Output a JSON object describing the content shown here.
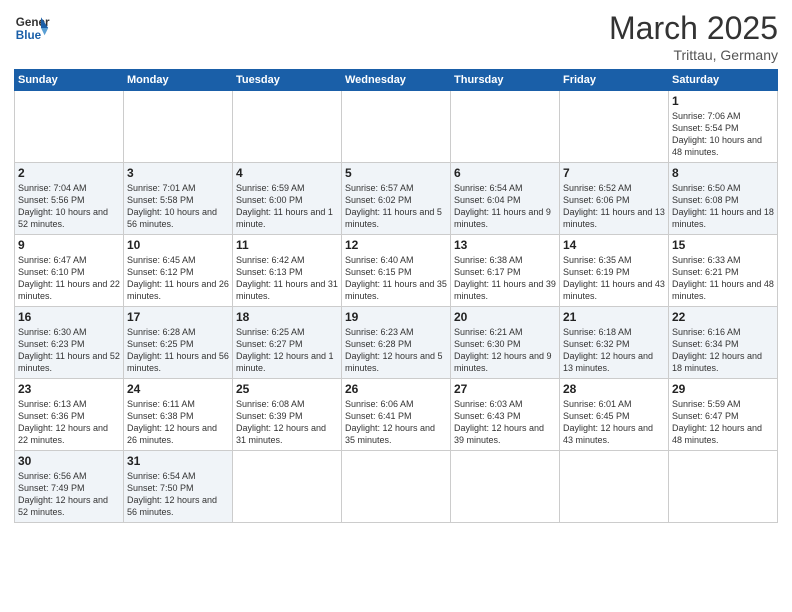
{
  "header": {
    "logo_text_general": "General",
    "logo_text_blue": "Blue",
    "month_title": "March 2025",
    "location": "Trittau, Germany"
  },
  "days_of_week": [
    "Sunday",
    "Monday",
    "Tuesday",
    "Wednesday",
    "Thursday",
    "Friday",
    "Saturday"
  ],
  "weeks": [
    [
      {
        "day": "",
        "info": ""
      },
      {
        "day": "",
        "info": ""
      },
      {
        "day": "",
        "info": ""
      },
      {
        "day": "",
        "info": ""
      },
      {
        "day": "",
        "info": ""
      },
      {
        "day": "",
        "info": ""
      },
      {
        "day": "1",
        "info": "Sunrise: 7:06 AM\nSunset: 5:54 PM\nDaylight: 10 hours and 48 minutes."
      }
    ],
    [
      {
        "day": "2",
        "info": "Sunrise: 7:04 AM\nSunset: 5:56 PM\nDaylight: 10 hours and 52 minutes."
      },
      {
        "day": "3",
        "info": "Sunrise: 7:01 AM\nSunset: 5:58 PM\nDaylight: 10 hours and 56 minutes."
      },
      {
        "day": "4",
        "info": "Sunrise: 6:59 AM\nSunset: 6:00 PM\nDaylight: 11 hours and 1 minute."
      },
      {
        "day": "5",
        "info": "Sunrise: 6:57 AM\nSunset: 6:02 PM\nDaylight: 11 hours and 5 minutes."
      },
      {
        "day": "6",
        "info": "Sunrise: 6:54 AM\nSunset: 6:04 PM\nDaylight: 11 hours and 9 minutes."
      },
      {
        "day": "7",
        "info": "Sunrise: 6:52 AM\nSunset: 6:06 PM\nDaylight: 11 hours and 13 minutes."
      },
      {
        "day": "8",
        "info": "Sunrise: 6:50 AM\nSunset: 6:08 PM\nDaylight: 11 hours and 18 minutes."
      }
    ],
    [
      {
        "day": "9",
        "info": "Sunrise: 6:47 AM\nSunset: 6:10 PM\nDaylight: 11 hours and 22 minutes."
      },
      {
        "day": "10",
        "info": "Sunrise: 6:45 AM\nSunset: 6:12 PM\nDaylight: 11 hours and 26 minutes."
      },
      {
        "day": "11",
        "info": "Sunrise: 6:42 AM\nSunset: 6:13 PM\nDaylight: 11 hours and 31 minutes."
      },
      {
        "day": "12",
        "info": "Sunrise: 6:40 AM\nSunset: 6:15 PM\nDaylight: 11 hours and 35 minutes."
      },
      {
        "day": "13",
        "info": "Sunrise: 6:38 AM\nSunset: 6:17 PM\nDaylight: 11 hours and 39 minutes."
      },
      {
        "day": "14",
        "info": "Sunrise: 6:35 AM\nSunset: 6:19 PM\nDaylight: 11 hours and 43 minutes."
      },
      {
        "day": "15",
        "info": "Sunrise: 6:33 AM\nSunset: 6:21 PM\nDaylight: 11 hours and 48 minutes."
      }
    ],
    [
      {
        "day": "16",
        "info": "Sunrise: 6:30 AM\nSunset: 6:23 PM\nDaylight: 11 hours and 52 minutes."
      },
      {
        "day": "17",
        "info": "Sunrise: 6:28 AM\nSunset: 6:25 PM\nDaylight: 11 hours and 56 minutes."
      },
      {
        "day": "18",
        "info": "Sunrise: 6:25 AM\nSunset: 6:27 PM\nDaylight: 12 hours and 1 minute."
      },
      {
        "day": "19",
        "info": "Sunrise: 6:23 AM\nSunset: 6:28 PM\nDaylight: 12 hours and 5 minutes."
      },
      {
        "day": "20",
        "info": "Sunrise: 6:21 AM\nSunset: 6:30 PM\nDaylight: 12 hours and 9 minutes."
      },
      {
        "day": "21",
        "info": "Sunrise: 6:18 AM\nSunset: 6:32 PM\nDaylight: 12 hours and 13 minutes."
      },
      {
        "day": "22",
        "info": "Sunrise: 6:16 AM\nSunset: 6:34 PM\nDaylight: 12 hours and 18 minutes."
      }
    ],
    [
      {
        "day": "23",
        "info": "Sunrise: 6:13 AM\nSunset: 6:36 PM\nDaylight: 12 hours and 22 minutes."
      },
      {
        "day": "24",
        "info": "Sunrise: 6:11 AM\nSunset: 6:38 PM\nDaylight: 12 hours and 26 minutes."
      },
      {
        "day": "25",
        "info": "Sunrise: 6:08 AM\nSunset: 6:39 PM\nDaylight: 12 hours and 31 minutes."
      },
      {
        "day": "26",
        "info": "Sunrise: 6:06 AM\nSunset: 6:41 PM\nDaylight: 12 hours and 35 minutes."
      },
      {
        "day": "27",
        "info": "Sunrise: 6:03 AM\nSunset: 6:43 PM\nDaylight: 12 hours and 39 minutes."
      },
      {
        "day": "28",
        "info": "Sunrise: 6:01 AM\nSunset: 6:45 PM\nDaylight: 12 hours and 43 minutes."
      },
      {
        "day": "29",
        "info": "Sunrise: 5:59 AM\nSunset: 6:47 PM\nDaylight: 12 hours and 48 minutes."
      }
    ],
    [
      {
        "day": "30",
        "info": "Sunrise: 6:56 AM\nSunset: 7:49 PM\nDaylight: 12 hours and 52 minutes."
      },
      {
        "day": "31",
        "info": "Sunrise: 6:54 AM\nSunset: 7:50 PM\nDaylight: 12 hours and 56 minutes."
      },
      {
        "day": "",
        "info": ""
      },
      {
        "day": "",
        "info": ""
      },
      {
        "day": "",
        "info": ""
      },
      {
        "day": "",
        "info": ""
      },
      {
        "day": "",
        "info": ""
      }
    ]
  ]
}
